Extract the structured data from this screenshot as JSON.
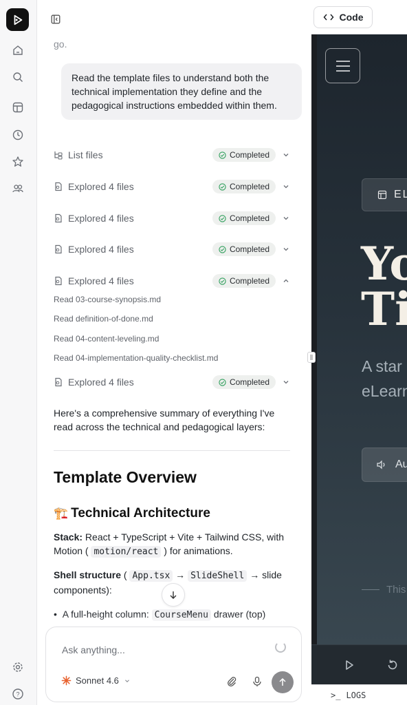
{
  "chat": {
    "top_fragment": "go.",
    "user_message": "Read the template files to understand both the technical implementation they define and the pedagogical instructions embedded within them.",
    "tool_calls": [
      {
        "label": "List files",
        "status": "Completed",
        "icon": "tree-icon",
        "expanded": false
      },
      {
        "label": "Explored 4 files",
        "status": "Completed",
        "icon": "file-icon",
        "expanded": false
      },
      {
        "label": "Explored 4 files",
        "status": "Completed",
        "icon": "file-icon",
        "expanded": false
      },
      {
        "label": "Explored 4 files",
        "status": "Completed",
        "icon": "file-icon",
        "expanded": false
      },
      {
        "label": "Explored 4 files",
        "status": "Completed",
        "icon": "file-icon",
        "expanded": true
      },
      {
        "label": "Explored 4 files",
        "status": "Completed",
        "icon": "file-icon",
        "expanded": false
      }
    ],
    "read_items": [
      "Read 03-course-synopsis.md",
      "Read definition-of-done.md",
      "Read 04-content-leveling.md",
      "Read 04-implementation-quality-checklist.md"
    ],
    "summary_intro": "Here's a comprehensive summary of everything I've read across the technical and pedagogical layers:",
    "h2": "Template Overview",
    "h3_emoji": "🏗️",
    "h3": "Technical Architecture",
    "stack_label": "Stack:",
    "stack_text_1": " React + TypeScript + Vite + Tailwind CSS, with Motion ( ",
    "stack_code": "motion/react",
    "stack_text_2": " ) for animations.",
    "shell_label": "Shell structure",
    "shell_open": " ( ",
    "shell_code_1": "App.tsx",
    "shell_arrow_1": " → ",
    "shell_code_2": "SlideShell",
    "shell_arrow_2": " → slide components):",
    "bullet_text_1": "A full-height column: ",
    "bullet_code": "CourseMenu",
    "bullet_text_2": " drawer (top)"
  },
  "composer": {
    "placeholder": "Ask anything...",
    "model": "Sonnet 4.6"
  },
  "preview": {
    "code_button": "Code",
    "pill_label": "EL",
    "title": "Yo\nTi",
    "subtitle": "A star\neLearn",
    "audio_label": "Au",
    "footer_text": "This",
    "logs_label": "LOGS"
  },
  "colors": {
    "badge_check": "#2e9e5b",
    "preview_bg": "#27323b",
    "title_color": "#f4efe6",
    "model_icon": "#e8602c"
  }
}
